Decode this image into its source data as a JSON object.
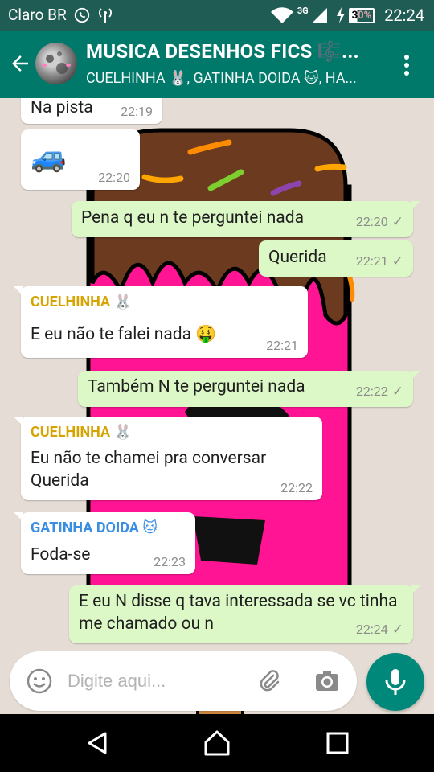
{
  "status_bar": {
    "carrier": "Claro BR",
    "network": "3G",
    "battery": "30%",
    "time": "22:24"
  },
  "header": {
    "title": "MUSICA DESENHOS FICS 🎼...",
    "subtitle": "CUELHINHA 🐰, GATINHA DOIDA 🐱, HA..."
  },
  "messages": [
    {
      "type": "in",
      "text": "Na pista",
      "time": "22:19"
    },
    {
      "type": "in",
      "text": "🚙",
      "time": "22:20"
    },
    {
      "type": "out",
      "text": "Pena q eu n te perguntei nada",
      "time": "22:20"
    },
    {
      "type": "out",
      "text": "Querida",
      "time": "22:21"
    },
    {
      "type": "in",
      "sender": "CUELHINHA 🐰",
      "sender_color": "#d6a400",
      "text": "E eu não te falei nada 🤑",
      "time": "22:21"
    },
    {
      "type": "out",
      "text": "Também N te perguntei nada",
      "time": "22:22"
    },
    {
      "type": "in",
      "sender": "CUELHINHA 🐰",
      "sender_color": "#d6a400",
      "text": "Eu não te chamei pra conversar Querida",
      "time": "22:22"
    },
    {
      "type": "in",
      "sender": "GATINHA DOIDA 🐱",
      "sender_color": "#3a8de0",
      "text": "Foda-se",
      "time": "22:23"
    },
    {
      "type": "out",
      "text": "E eu N disse q tava interessada se vc tinha me chamado ou n",
      "time": "22:24"
    }
  ],
  "input": {
    "placeholder": "Digite aqui..."
  },
  "colors": {
    "header": "#00796b",
    "status_bar": "#1f5c53",
    "outgoing_bubble": "#dcf8c6",
    "incoming_bubble": "#ffffff",
    "mic_button": "#00897b",
    "wallpaper_pink": "#ff1493",
    "wallpaper_chocolate": "#6b3a1f"
  },
  "icons": [
    "whatsapp-icon",
    "hotspot-icon",
    "wifi-icon",
    "signal-icon",
    "battery-icon",
    "back-arrow-icon",
    "more-vert-icon",
    "emoji-icon",
    "attach-icon",
    "camera-icon",
    "mic-icon",
    "nav-back-icon",
    "nav-home-icon",
    "nav-recents-icon"
  ]
}
